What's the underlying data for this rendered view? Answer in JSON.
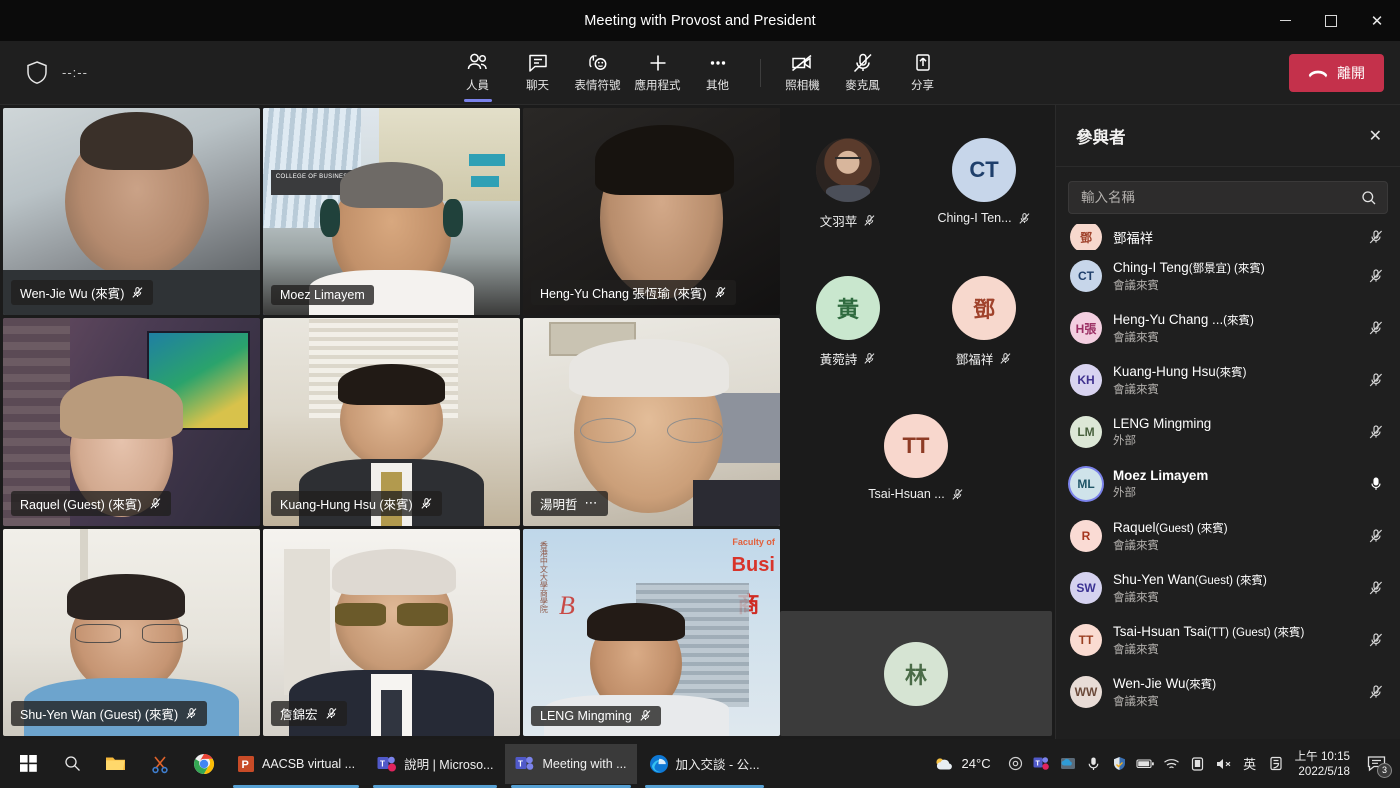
{
  "window": {
    "title": "Meeting with Provost and President",
    "controls": {
      "minimize": "–",
      "maximize": "□",
      "close": "✕"
    }
  },
  "toolbar": {
    "timer": "--:--",
    "items": [
      {
        "label": "人員",
        "icon": "people-icon",
        "active": true
      },
      {
        "label": "聊天",
        "icon": "chat-icon",
        "active": false
      },
      {
        "label": "表情符號",
        "icon": "reactions-icon",
        "active": false
      },
      {
        "label": "應用程式",
        "icon": "apps-icon",
        "active": false
      },
      {
        "label": "其他",
        "icon": "more-icon",
        "active": false
      }
    ],
    "devices": [
      {
        "label": "照相機",
        "icon": "camera-off-icon"
      },
      {
        "label": "麥克風",
        "icon": "mic-off-icon"
      },
      {
        "label": "分享",
        "icon": "share-icon"
      }
    ],
    "leave_label": "離開",
    "accent": "#7b83eb",
    "leave_color": "#c4314b"
  },
  "video_grid": [
    {
      "name": "Wen-Jie Wu (來賓)",
      "muted": true,
      "speaking": false,
      "menu": false
    },
    {
      "name": "Moez Limayem",
      "muted": false,
      "speaking": true,
      "menu": false
    },
    {
      "name": "Heng-Yu Chang 張恆瑜 (來賓)",
      "muted": true,
      "speaking": false,
      "menu": false
    },
    {
      "name": "Raquel (Guest) (來賓)",
      "muted": true,
      "speaking": false,
      "menu": false
    },
    {
      "name": "Kuang-Hung Hsu (來賓)",
      "muted": true,
      "speaking": false,
      "menu": false
    },
    {
      "name": "湯明哲",
      "muted": false,
      "speaking": true,
      "menu": true
    },
    {
      "name": "Shu-Yen Wan (Guest) (來賓)",
      "muted": true,
      "speaking": false,
      "menu": false
    },
    {
      "name": "詹錦宏",
      "muted": true,
      "speaking": false,
      "menu": false
    },
    {
      "name": "LENG Mingming",
      "muted": true,
      "speaking": false,
      "menu": false
    }
  ],
  "audio_participants": [
    {
      "name": "文羽苹",
      "initials": "",
      "photo": true,
      "bg": "#3a3330",
      "fg": "#ffffff",
      "muted": true
    },
    {
      "name": "Ching-I Ten...",
      "initials": "CT",
      "photo": false,
      "bg": "#c7d6ea",
      "fg": "#1f3f6b",
      "muted": true
    },
    {
      "name": "黃菀詩",
      "initials": "黃",
      "photo": false,
      "bg": "#c9e7ce",
      "fg": "#2f6b3f",
      "muted": true
    },
    {
      "name": "鄧福祥",
      "initials": "鄧",
      "photo": false,
      "bg": "#f7d8cd",
      "fg": "#a0432c",
      "muted": true
    },
    {
      "name": "Tsai-Hsuan ...",
      "initials": "TT",
      "photo": false,
      "bg": "#f8d7cd",
      "fg": "#8e3b25",
      "muted": true
    }
  ],
  "extra_tile": {
    "initials": "林",
    "bg": "#d6e4d3",
    "fg": "#4a6b47"
  },
  "panel": {
    "title": "參與者",
    "close_icon": "close-icon",
    "search_placeholder": "輸入名稱",
    "search_value": "",
    "partial_top": {
      "name": "鄧福祥",
      "initials": "鄧",
      "bg": "#f7d8cd",
      "fg": "#a0432c",
      "muted": true
    },
    "participants": [
      {
        "name": "Ching-I Teng",
        "suffix": "(鄧景宜) (來賓)",
        "role": "會議來賓",
        "initials": "CT",
        "bg": "#c7d6ea",
        "fg": "#1f3f6b",
        "muted": true,
        "speaking": false
      },
      {
        "name": "Heng-Yu Chang ...",
        "suffix": "(來賓)",
        "role": "會議來賓",
        "initials": "H張",
        "bg": "#f3cfe0",
        "fg": "#9b2f63",
        "muted": true,
        "speaking": false
      },
      {
        "name": "Kuang-Hung Hsu",
        "suffix": "(來賓)",
        "role": "會議來賓",
        "initials": "KH",
        "bg": "#d8d3f0",
        "fg": "#40318f",
        "muted": true,
        "speaking": false
      },
      {
        "name": "LENG Mingming",
        "suffix": "",
        "role": "外部",
        "initials": "LM",
        "bg": "#dce7d6",
        "fg": "#47603c",
        "muted": true,
        "speaking": false
      },
      {
        "name": "Moez Limayem",
        "suffix": "",
        "role": "外部",
        "initials": "ML",
        "bg": "#cfe3ea",
        "fg": "#1f5567",
        "muted": false,
        "speaking": true
      },
      {
        "name": "Raquel",
        "suffix": "(Guest) (來賓)",
        "role": "會議來賓",
        "initials": "R",
        "bg": "#fadbd4",
        "fg": "#a6361f",
        "muted": true,
        "speaking": false
      },
      {
        "name": "Shu-Yen Wan",
        "suffix": "(Guest) (來賓)",
        "role": "會議來賓",
        "initials": "SW",
        "bg": "#d5d2ef",
        "fg": "#3b3293",
        "muted": true,
        "speaking": false
      },
      {
        "name": "Tsai-Hsuan Tsai",
        "suffix": "(TT) (Guest) (來賓)",
        "role": "會議來賓",
        "initials": "TT",
        "bg": "#fadbd1",
        "fg": "#9a3f22",
        "muted": true,
        "speaking": false
      },
      {
        "name": "Wen-Jie Wu",
        "suffix": "(來賓)",
        "role": "會議來賓",
        "initials": "WW",
        "bg": "#e8dcd6",
        "fg": "#6b4a3a",
        "muted": true,
        "speaking": false
      }
    ]
  },
  "taskbar": {
    "start_icon": "windows-start-icon",
    "search_icon": "search-icon",
    "apps": [
      {
        "label": "",
        "icon": "file-explorer-icon",
        "pinned": true,
        "active": false
      },
      {
        "label": "",
        "icon": "snipping-tool-icon",
        "pinned": true,
        "active": false
      },
      {
        "label": "",
        "icon": "chrome-icon",
        "pinned": true,
        "active": false
      },
      {
        "label": "AACSB virtual ...",
        "icon": "powerpoint-icon",
        "pinned": false,
        "active": false
      },
      {
        "label": "說明 | Microso...",
        "icon": "teams-icon",
        "pinned": false,
        "active": false
      },
      {
        "label": "Meeting with ...",
        "icon": "teams-icon",
        "pinned": false,
        "active": true
      },
      {
        "label": "加入交談 - 公...",
        "icon": "edge-icon",
        "pinned": false,
        "active": false
      }
    ],
    "weather": {
      "icon": "partly-cloudy-icon",
      "temperature": "24°C"
    },
    "tray_icons": [
      "circle-icon",
      "teams-icon",
      "onedrive-icon",
      "mic-icon",
      "security-icon",
      "battery-icon",
      "wifi-icon",
      "display-icon",
      "volume-mute-icon",
      "ime-english-icon",
      "ime-tool-icon"
    ],
    "ime_label": "英",
    "clock": {
      "time": "上午 10:15",
      "date": "2022/5/18"
    },
    "notification_count": "3"
  }
}
